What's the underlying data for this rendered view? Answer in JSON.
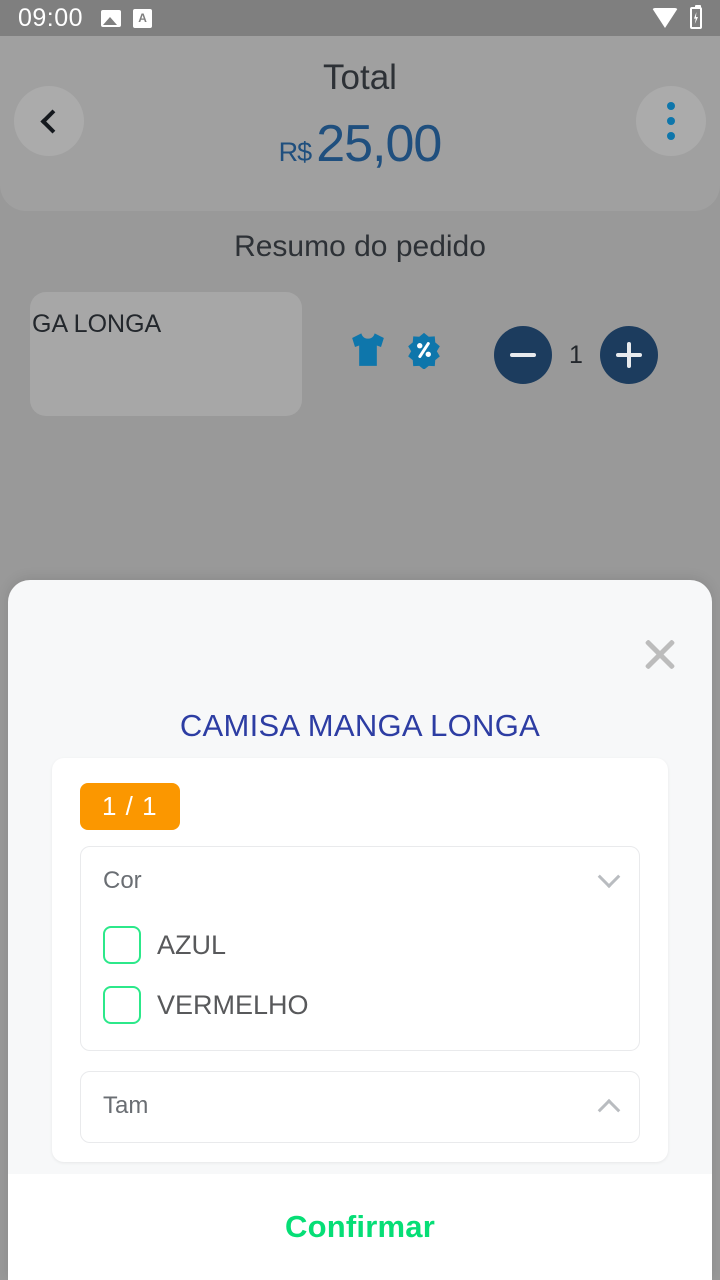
{
  "status_bar": {
    "clock": "09:00",
    "left_icons": [
      "image-icon",
      "app-letter-icon"
    ],
    "right_icons": [
      "wifi-icon",
      "battery-charging-icon"
    ]
  },
  "header": {
    "back_icon": "chevron-left-icon",
    "menu_icon": "more-vertical-icon",
    "total_label": "Total",
    "currency": "R$",
    "amount": "25,00",
    "accent_color": "#1f4f7e"
  },
  "summary": {
    "title": "Resumo do pedido",
    "item": {
      "name": "GA LONGA",
      "product_icon": "tshirt-icon",
      "discount_icon": "percent-badge-icon",
      "decrease_label": "−",
      "quantity": "1",
      "increase_label": "+"
    }
  },
  "sheet": {
    "close_icon": "close-icon",
    "title": "CAMISA MANGA LONGA",
    "count_badge": "1 / 1",
    "badge_color": "#fb9700",
    "groups": [
      {
        "label": "Cor",
        "chevron": "chevron-down-icon",
        "expanded": true,
        "options": [
          {
            "label": "AZUL",
            "checked": false
          },
          {
            "label": "VERMELHO",
            "checked": false
          }
        ]
      },
      {
        "label": "Tam",
        "chevron": "chevron-up-icon",
        "expanded": false,
        "options": []
      }
    ],
    "confirm_label": "Confirmar",
    "confirm_color": "#06de76",
    "checkbox_color": "#2ce88a"
  }
}
